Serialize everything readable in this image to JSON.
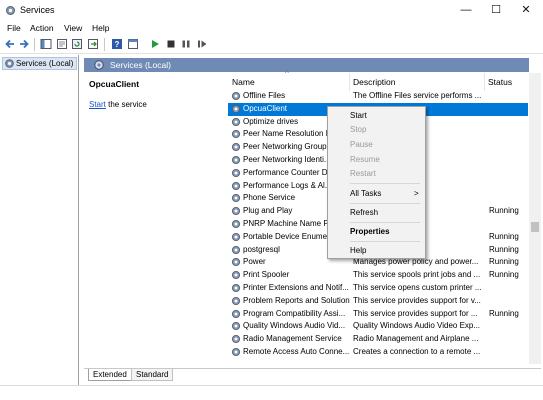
{
  "window": {
    "title": "Services",
    "controls": {
      "minimize": "—",
      "maximize": "☐",
      "close": "✕"
    }
  },
  "menu": [
    "File",
    "Action",
    "View",
    "Help"
  ],
  "tree": {
    "item": "Services (Local)"
  },
  "panel": {
    "header": "Services (Local)",
    "selected_name": "OpcuaClient",
    "start_link": "Start",
    "start_rest": " the service"
  },
  "columns": {
    "name": "Name",
    "description": "Description",
    "status": "Status",
    "sort_indicator": "^"
  },
  "rows": [
    {
      "name": "Offline Files",
      "description": "The Offline Files service performs ...",
      "status": ""
    },
    {
      "name": "OpcuaClient",
      "description": "",
      "status": "",
      "selected": true
    },
    {
      "name": "Optimize drives",
      "description": "run more effi...",
      "status": ""
    },
    {
      "name": "Peer Name Resolution P...",
      "description": "er name resol...",
      "status": ""
    },
    {
      "name": "Peer Networking Group...",
      "description": "communicati...",
      "status": ""
    },
    {
      "name": "Peer Networking Identi...",
      "description": "ices for the P...",
      "status": ""
    },
    {
      "name": "Performance Counter D...",
      "description": "and 64-bit p...",
      "status": ""
    },
    {
      "name": "Performance Logs & Al...",
      "description": "and Alerts Col...",
      "status": ""
    },
    {
      "name": "Phone Service",
      "description": "ny state on t...",
      "status": ""
    },
    {
      "name": "Plug and Play",
      "description": "to recognize ...",
      "status": "Running"
    },
    {
      "name": "PNRP Machine Name P...",
      "description": "s a machine ...",
      "status": ""
    },
    {
      "name": "Portable Device Enumer...",
      "description": "for remova...",
      "status": "Running"
    },
    {
      "name": "postgresql",
      "description": "erver",
      "status": "Running"
    },
    {
      "name": "Power",
      "description": "Manages power policy and power...",
      "status": "Running"
    },
    {
      "name": "Print Spooler",
      "description": "This service spools print jobs and ...",
      "status": "Running"
    },
    {
      "name": "Printer Extensions and Notif...",
      "description": "This service opens custom printer ...",
      "status": ""
    },
    {
      "name": "Problem Reports and Solution...",
      "description": "This service provides support for v...",
      "status": ""
    },
    {
      "name": "Program Compatibility Assi...",
      "description": "This service provides support for ...",
      "status": "Running"
    },
    {
      "name": "Quality Windows Audio Vid...",
      "description": "Quality Windows Audio Video Exp...",
      "status": ""
    },
    {
      "name": "Radio Management Service",
      "description": "Radio Management and Airplane ...",
      "status": ""
    },
    {
      "name": "Remote Access Auto Conne...",
      "description": "Creates a connection to a remote ...",
      "status": ""
    }
  ],
  "tabs": [
    "Extended",
    "Standard"
  ],
  "context_menu": {
    "start": "Start",
    "stop": "Stop",
    "pause": "Pause",
    "resume": "Resume",
    "restart": "Restart",
    "all_tasks": "All Tasks",
    "all_tasks_arrow": ">",
    "refresh": "Refresh",
    "properties": "Properties",
    "help": "Help"
  },
  "colors": {
    "selection": "#0078d7",
    "header_band": "#6f8bb5",
    "link": "#1a55c9"
  }
}
